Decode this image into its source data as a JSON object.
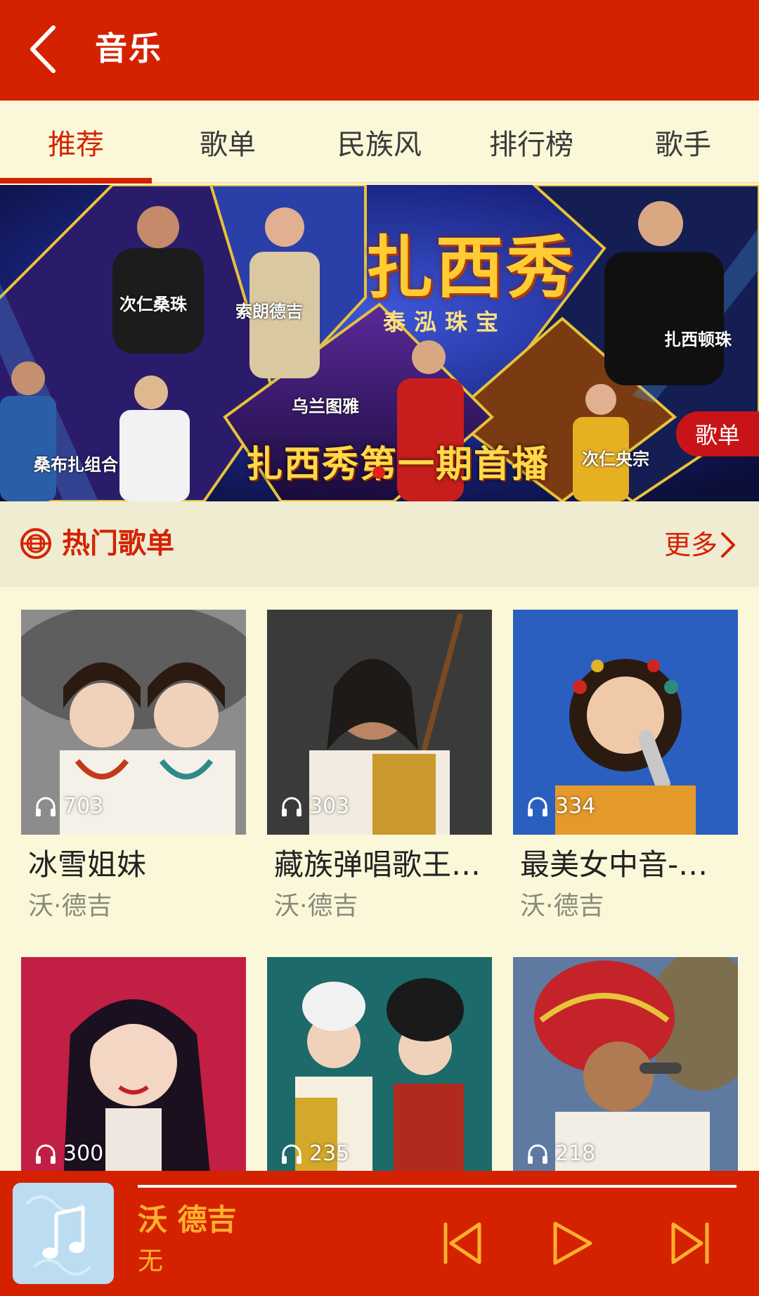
{
  "header": {
    "title": "音乐"
  },
  "tabs": [
    {
      "label": "推荐",
      "active": true
    },
    {
      "label": "歌单",
      "active": false
    },
    {
      "label": "民族风",
      "active": false
    },
    {
      "label": "排行榜",
      "active": false
    },
    {
      "label": "歌手",
      "active": false
    }
  ],
  "banner": {
    "logo_text": "扎西秀",
    "sub_text": "泰泓珠宝",
    "headline": "扎西秀第一期首播",
    "captions": [
      "次仁桑珠",
      "索朗德吉",
      "乌兰图雅",
      "扎西顿珠",
      "桑布扎组合",
      "次仁央宗"
    ],
    "tag": "歌单",
    "active_slide": 1
  },
  "section": {
    "title": "热门歌单",
    "more_label": "更多"
  },
  "playlists": [
    {
      "title": "冰雪姐妹",
      "artist": "沃·德吉",
      "plays": "703"
    },
    {
      "title": "藏族弹唱歌王…",
      "artist": "沃·德吉",
      "plays": "303"
    },
    {
      "title": "最美女中音-…",
      "artist": "沃·德吉",
      "plays": "334"
    },
    {
      "title": "",
      "artist": "",
      "plays": "300"
    },
    {
      "title": "",
      "artist": "",
      "plays": "235"
    },
    {
      "title": "",
      "artist": "",
      "plays": "218"
    }
  ],
  "player": {
    "song": "沃 德吉",
    "subtitle": "无",
    "progress": 0
  },
  "colors": {
    "primary": "#d42200",
    "background": "#fbf8d9",
    "accent": "#ffb02e"
  }
}
